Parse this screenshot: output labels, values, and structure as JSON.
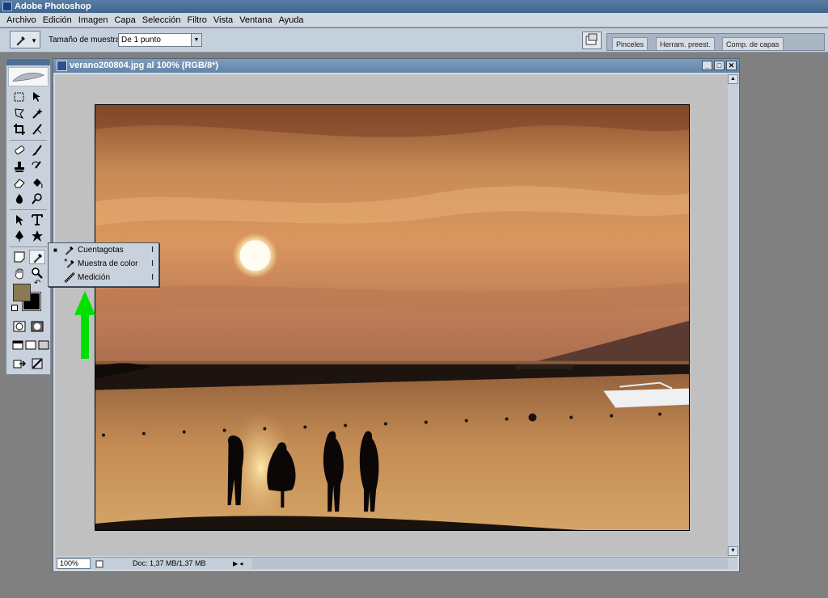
{
  "app": {
    "title": "Adobe Photoshop"
  },
  "menu": [
    "Archivo",
    "Edición",
    "Imagen",
    "Capa",
    "Selección",
    "Filtro",
    "Vista",
    "Ventana",
    "Ayuda"
  ],
  "options": {
    "sample_label": "Tamaño de muestra:",
    "sample_value": "De 1 punto",
    "well_tabs": [
      "Pinceles",
      "Herram. preest.",
      "Comp. de capas"
    ]
  },
  "flyout": [
    {
      "label": "Cuentagotas",
      "key": "I",
      "selected": true,
      "icon": "eyedropper-icon"
    },
    {
      "label": "Muestra de color",
      "key": "I",
      "selected": false,
      "icon": "color-sampler-icon"
    },
    {
      "label": "Medición",
      "key": "I",
      "selected": false,
      "icon": "measure-icon"
    }
  ],
  "colors": {
    "foreground": "#8a7a52",
    "background": "#000000",
    "highlight_arrow": "#00e000"
  },
  "document": {
    "title": "verano200804.jpg al 100% (RGB/8*)",
    "zoom": "100%",
    "doc_info": "Doc: 1,37 MB/1,37 MB"
  }
}
